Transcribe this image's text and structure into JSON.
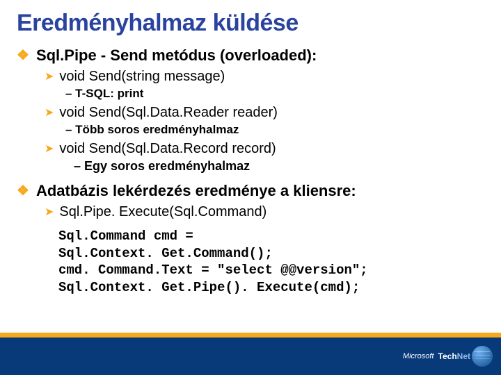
{
  "title": "Eredményhalmaz küldése",
  "items": [
    {
      "level": 1,
      "bullet": "❖",
      "text": "Sql.Pipe - Send metódus (overloaded):"
    },
    {
      "level": 2,
      "bullet": "➤",
      "text": "void Send(string message)"
    },
    {
      "level": 3,
      "text": "– T-SQL: print"
    },
    {
      "level": 2,
      "bullet": "➤",
      "text": "void Send(Sql.Data.Reader reader)"
    },
    {
      "level": 3,
      "text": "– Több soros eredményhalmaz"
    },
    {
      "level": 2,
      "bullet": "➤",
      "text": "void Send(Sql.Data.Record record)"
    },
    {
      "level": "3b",
      "text": "– Egy soros eredményhalmaz"
    },
    {
      "level": 1,
      "bullet": "❖",
      "text": "Adatbázis lekérdezés eredménye a kliensre:"
    },
    {
      "level": 2,
      "bullet": "➤",
      "text": "Sql.Pipe. Execute(Sql.Command)"
    }
  ],
  "code": "Sql.Command cmd =\nSql.Context. Get.Command();\ncmd. Command.Text = \"select @@version\";\nSql.Context. Get.Pipe(). Execute(cmd);",
  "footer": {
    "brand": "Microsoft",
    "logo_label_1": "Tech",
    "logo_label_2": "Net"
  }
}
